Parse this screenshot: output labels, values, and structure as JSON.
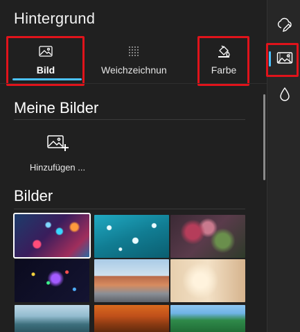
{
  "panel": {
    "title": "Hintergrund"
  },
  "tabs": [
    {
      "label": "Bild",
      "icon": "image-icon",
      "selected": true
    },
    {
      "label": "Weichzeichnun",
      "icon": "blur-icon",
      "selected": false
    },
    {
      "label": "Farbe",
      "icon": "paint-bucket-icon",
      "selected": false
    }
  ],
  "my_images": {
    "heading": "Meine Bilder",
    "add_label": "Hinzufügen ...",
    "add_icon": "add-image-icon"
  },
  "images": {
    "heading": "Bilder",
    "thumbnails": [
      {
        "name": "colorful-rain-drops",
        "selected": true
      },
      {
        "name": "teal-bubbles",
        "selected": false
      },
      {
        "name": "blurred-flowers",
        "selected": false
      },
      {
        "name": "colorful-lights",
        "selected": false
      },
      {
        "name": "street-houses",
        "selected": false
      },
      {
        "name": "bright-room",
        "selected": false
      },
      {
        "name": "misty-mountains",
        "selected": false
      },
      {
        "name": "autumn-trees",
        "selected": false
      },
      {
        "name": "tropical-beach",
        "selected": false
      }
    ]
  },
  "rail": {
    "items": [
      {
        "icon": "cloud-edit-icon",
        "active": false
      },
      {
        "icon": "background-image-icon",
        "active": true
      },
      {
        "icon": "water-drop-icon",
        "active": false
      }
    ]
  },
  "colors": {
    "accent": "#4cc2ff",
    "highlight": "#e0131b",
    "panel_bg": "#202020"
  }
}
